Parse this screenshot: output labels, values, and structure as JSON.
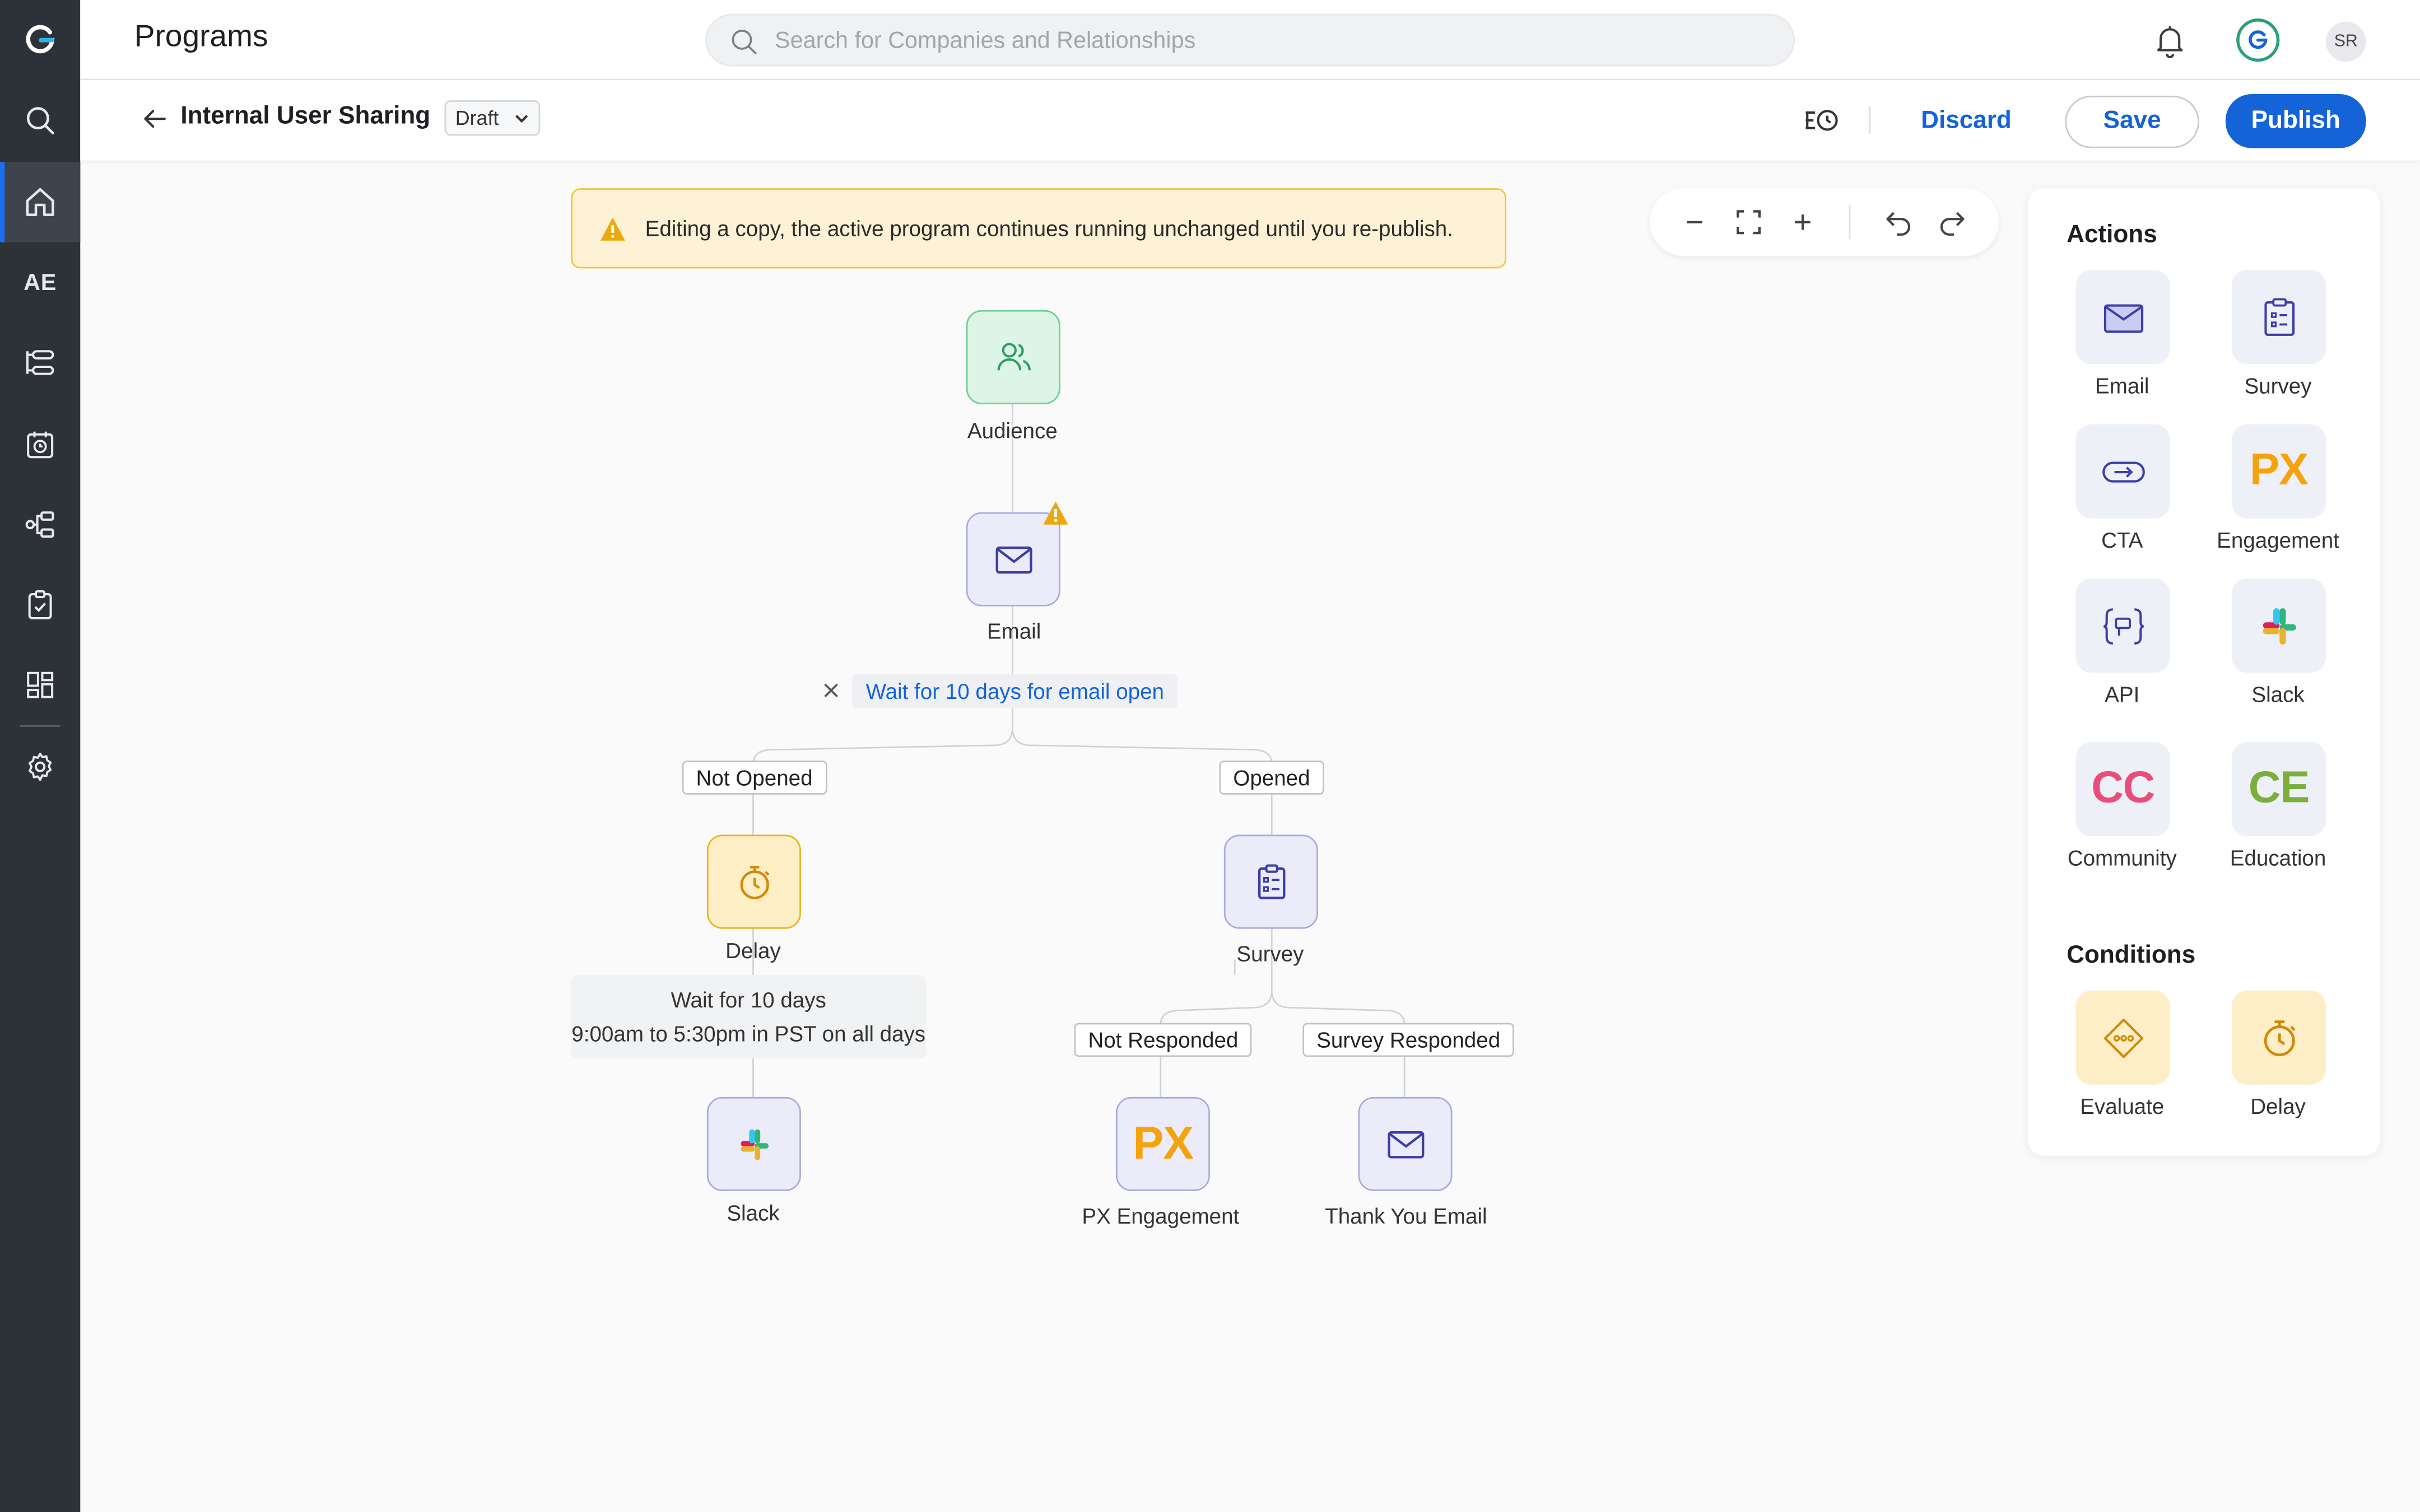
{
  "header": {
    "page_title": "Programs",
    "search_placeholder": "Search for Companies and Relationships",
    "user_initials": "SR"
  },
  "rail": {
    "logo": "G",
    "items": [
      "search-icon",
      "home-icon",
      "AE",
      "timeline-list-icon",
      "calendar-clock-icon",
      "workflow-icon",
      "clipboard-check-icon",
      "dashboard-icon",
      "gear-icon"
    ],
    "ae_label": "AE"
  },
  "program": {
    "name": "Internal User Sharing",
    "status": "Draft"
  },
  "toolbar": {
    "discard": "Discard",
    "save": "Save",
    "publish": "Publish"
  },
  "banner": {
    "message": "Editing a copy, the active program continues running unchanged until you re-publish."
  },
  "canvas": {
    "audience_label": "Audience",
    "email_label": "Email",
    "wait_condition": "Wait for 10 days for email open",
    "branch_not_opened": "Not Opened",
    "branch_opened": "Opened",
    "delay_label": "Delay",
    "delay_line1": "Wait for 10 days",
    "delay_line2": "9:00am to 5:30pm in PST on all days",
    "slack_label": "Slack",
    "survey_label": "Survey",
    "branch_not_responded": "Not Responded",
    "branch_survey_responded": "Survey Responded",
    "px_label": "PX Engagement",
    "px_mark": "PX",
    "thank_you_label": "Thank You Email"
  },
  "panel": {
    "actions_title": "Actions",
    "actions": {
      "email": "Email",
      "survey": "Survey",
      "cta": "CTA",
      "engagement": "Engagement",
      "engagement_mark": "PX",
      "api": "API",
      "slack": "Slack",
      "community": "Community",
      "community_mark": "CC",
      "education": "Education",
      "education_mark": "CE"
    },
    "conditions_title": "Conditions",
    "conditions": {
      "evaluate": "Evaluate",
      "delay": "Delay"
    }
  },
  "colors": {
    "rail_bg": "#2d3238",
    "accent_blue": "#1463d9",
    "warning_bg": "#fdf2d6",
    "warning_border": "#f0c43c",
    "px_orange": "#f4a30f",
    "cc_pink": "#e94d7a",
    "ce_green": "#7cae3c"
  }
}
